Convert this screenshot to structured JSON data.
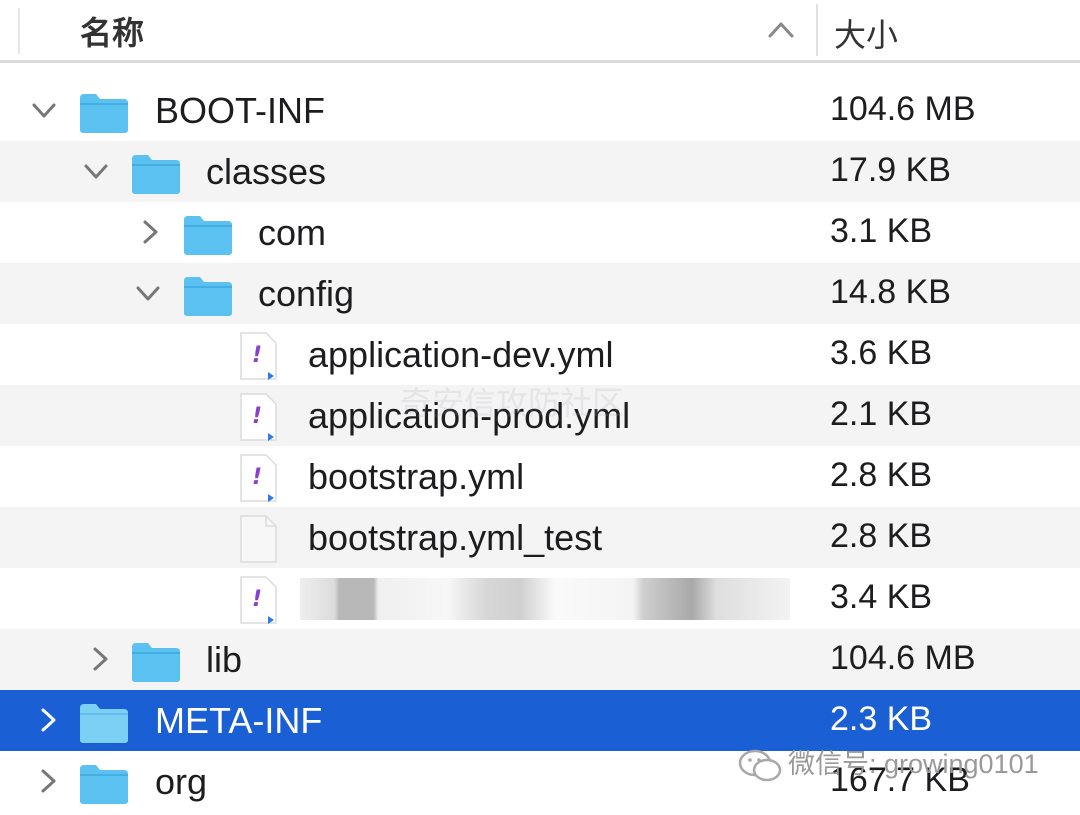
{
  "header": {
    "name_label": "名称",
    "size_label": "大小",
    "sort_icon": "chevron-up-icon"
  },
  "rows": [
    {
      "name": "BOOT-INF",
      "size": "104.6 MB",
      "kind": "folder",
      "expanded": true
    },
    {
      "name": "classes",
      "size": "17.9 KB",
      "kind": "folder",
      "expanded": true
    },
    {
      "name": "com",
      "size": "3.1 KB",
      "kind": "folder",
      "expanded": false
    },
    {
      "name": "config",
      "size": "14.8 KB",
      "kind": "folder",
      "expanded": true
    },
    {
      "name": "application-dev.yml",
      "size": "3.6 KB",
      "kind": "yml-file"
    },
    {
      "name": "application-prod.yml",
      "size": "2.1 KB",
      "kind": "yml-file"
    },
    {
      "name": "bootstrap.yml",
      "size": "2.8 KB",
      "kind": "yml-file"
    },
    {
      "name": "bootstrap.yml_test",
      "size": "2.8 KB",
      "kind": "plain-file"
    },
    {
      "name": "",
      "size": "3.4 KB",
      "kind": "yml-file",
      "redacted": true
    },
    {
      "name": "lib",
      "size": "104.6 MB",
      "kind": "folder",
      "expanded": false
    },
    {
      "name": "META-INF",
      "size": "2.3 KB",
      "kind": "folder",
      "expanded": false,
      "selected": true
    },
    {
      "name": "org",
      "size": "167.7 KB",
      "kind": "folder",
      "expanded": false
    }
  ],
  "watermark": {
    "text": "微信号: growing0101",
    "center_text": "奇安信攻防社区"
  },
  "colors": {
    "folder": "#5ac1f0",
    "selection": "#1a5fd4",
    "yml_icon": "#8a3fd1"
  }
}
